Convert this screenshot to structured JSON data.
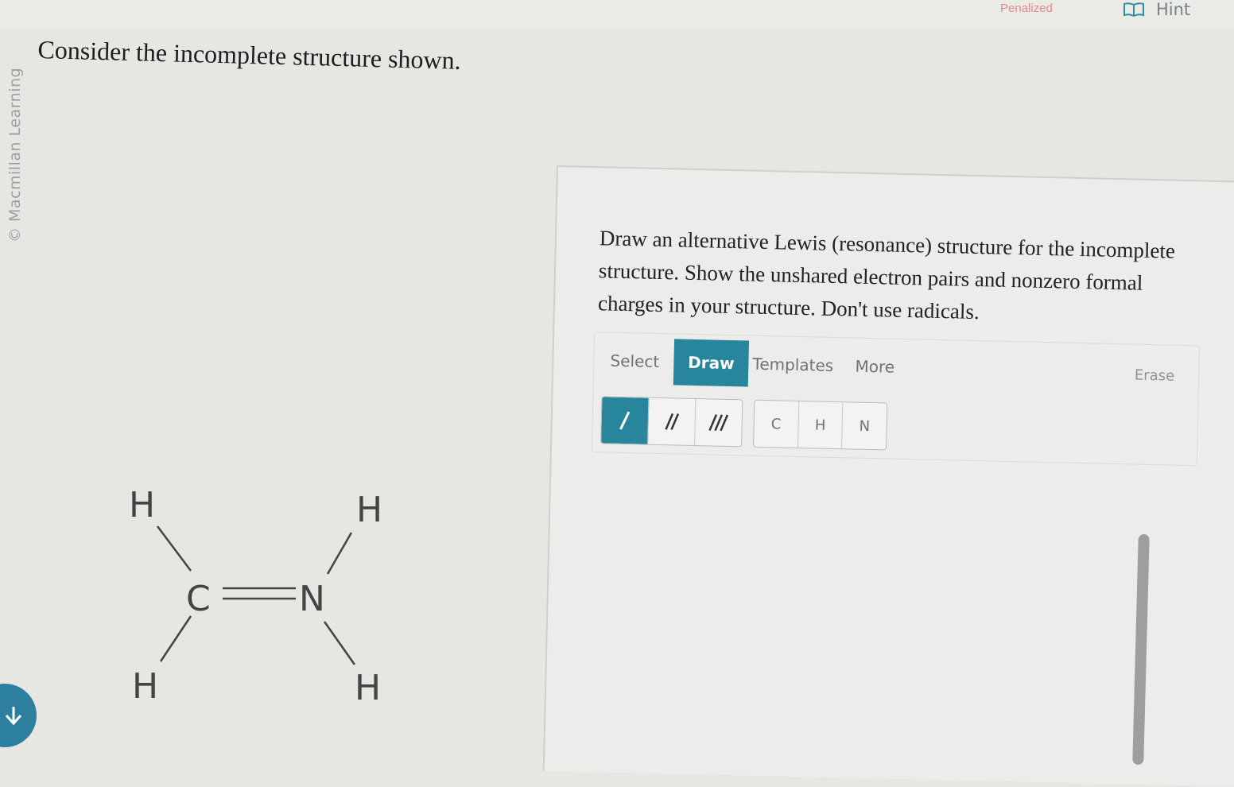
{
  "header": {
    "penalized_label": "Penalized",
    "hint_label": "Hint"
  },
  "credit": "© Macmillan Learning",
  "question": "Consider the incomplete structure shown.",
  "molecule": {
    "atoms": {
      "h_top_left": "H",
      "h_bottom_left": "H",
      "carbon": "C",
      "nitrogen": "N",
      "h_top_right": "H",
      "h_bottom_right": "H"
    }
  },
  "instructions": "Draw an alternative Lewis (resonance) structure for the incomplete structure. Show the unshared electron pairs and nonzero formal charges in your structure. Don't use radicals.",
  "editor": {
    "tabs": {
      "select": "Select",
      "draw": "Draw",
      "templates": "Templates",
      "more": "More"
    },
    "active_tab": "Draw",
    "erase": "Erase",
    "active_bond": "single",
    "atoms": {
      "c": "C",
      "h": "H",
      "n": "N"
    }
  },
  "colors": {
    "accent": "#27869c",
    "penalized": "#e08a8a"
  },
  "icons": [
    "book-icon",
    "single-bond-icon",
    "double-bond-icon",
    "triple-bond-icon",
    "arrow-down-icon"
  ]
}
